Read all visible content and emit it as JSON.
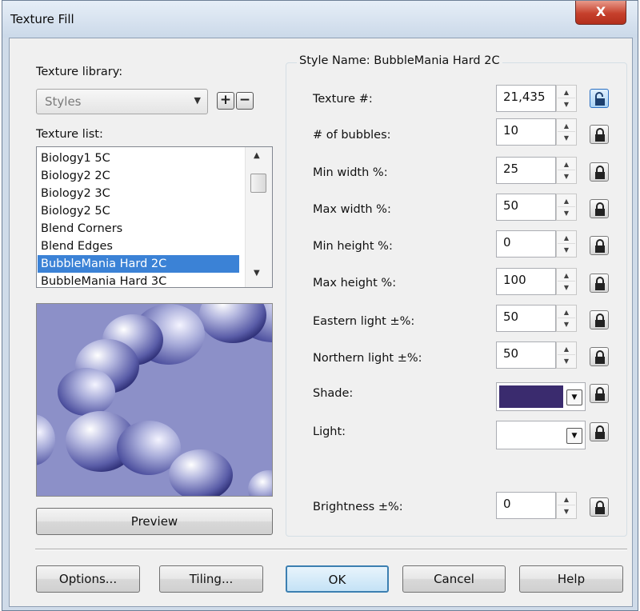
{
  "window": {
    "title": "Texture Fill",
    "close_label": "X"
  },
  "library": {
    "label": "Texture library:",
    "selected": "Styles",
    "add_label": "+",
    "remove_label": "−"
  },
  "texture_list": {
    "label": "Texture list:",
    "items": [
      "Biology1 5C",
      "Biology2 2C",
      "Biology2 3C",
      "Biology2 5C",
      "Blend Corners",
      "Blend Edges",
      "BubbleMania Hard 2C",
      "BubbleMania Hard 3C"
    ],
    "selected_index": 6
  },
  "preview": {
    "label": "Preview"
  },
  "style": {
    "title": "Style Name: BubbleMania Hard 2C",
    "params": [
      {
        "label": "Texture #:",
        "value": "21,435",
        "locked": false
      },
      {
        "label": "# of bubbles:",
        "value": "10",
        "locked": true
      },
      {
        "label": "Min width %:",
        "value": "25",
        "locked": true
      },
      {
        "label": "Max width %:",
        "value": "50",
        "locked": true
      },
      {
        "label": "Min height %:",
        "value": "0",
        "locked": true
      },
      {
        "label": "Max height %:",
        "value": "100",
        "locked": true
      },
      {
        "label": "Eastern light ±%:",
        "value": "50",
        "locked": true
      },
      {
        "label": "Northern light ±%:",
        "value": "50",
        "locked": true
      }
    ],
    "shade": {
      "label": "Shade:",
      "color": "#3a2b6e"
    },
    "light": {
      "label": "Light:",
      "color": "#ffffff"
    },
    "brightness": {
      "label": "Brightness ±%:",
      "value": "0"
    }
  },
  "buttons": {
    "options": "Options...",
    "tiling": "Tiling...",
    "ok": "OK",
    "cancel": "Cancel",
    "help": "Help"
  },
  "colors": {
    "accent": "#3b82d6",
    "frame": "#cfdbe9",
    "face": "#f0f0f0"
  }
}
